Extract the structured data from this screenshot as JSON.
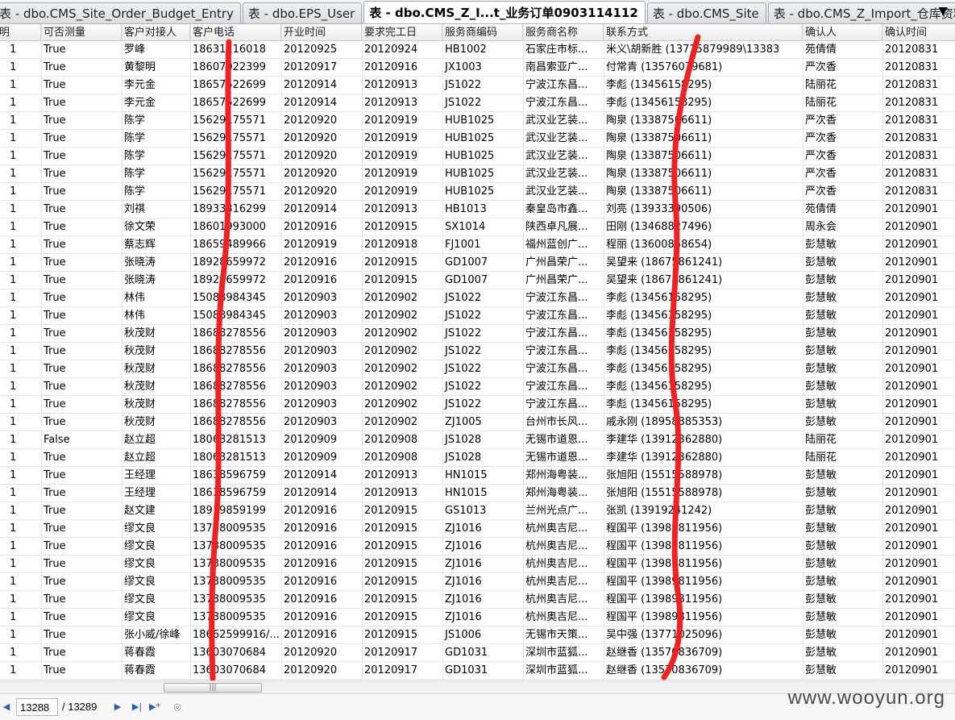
{
  "tabs": [
    {
      "label": "表 - dbo.CMS_Site_Order_Budget_Entry",
      "active": false
    },
    {
      "label": "表 - dbo.EPS_User",
      "active": false
    },
    {
      "label": "表 - dbo.CMS_Z_I...t_业务订单0903114112",
      "active": true
    },
    {
      "label": "表 - dbo.CMS_Site",
      "active": false
    },
    {
      "label": "表 - dbo.CMS_Z_Import_仓库资料",
      "active": false
    }
  ],
  "tab_overflow_icon": "▼",
  "columns": [
    "明",
    "可否测量",
    "客户对接人",
    "客户电话",
    "开业时间",
    "要求完工日",
    "服务商编码",
    "服务商名称",
    "联系方式",
    "确认人",
    "确认时间"
  ],
  "rows": [
    [
      "1",
      "True",
      "罗峰",
      "18631116018",
      "20120925",
      "20120924",
      "HB1002",
      "石家庄市标...",
      "米义\\胡新胜 (13715879989\\13383",
      "苑倩倩",
      "20120831"
    ],
    [
      "1",
      "True",
      "黄黎明",
      "18607022399",
      "20120917",
      "20120916",
      "JX1003",
      "南昌索亚广...",
      "付常青 (13576079681)",
      "严次香",
      "20120831"
    ],
    [
      "1",
      "True",
      "李元金",
      "18657522699",
      "20120914",
      "20120913",
      "JS1022",
      "宁波江东昌...",
      "李彪 (13456158295)",
      "陆丽花",
      "20120831"
    ],
    [
      "1",
      "True",
      "李元金",
      "18657522699",
      "20120914",
      "20120913",
      "JS1022",
      "宁波江东昌...",
      "李彪 (13456158295)",
      "陆丽花",
      "20120831"
    ],
    [
      "1",
      "True",
      "陈学",
      "15629175571",
      "20120920",
      "20120919",
      "HUB1025",
      "武汉业艺装...",
      "陶泉 (13387506611)",
      "严次香",
      "20120831"
    ],
    [
      "1",
      "True",
      "陈学",
      "15629175571",
      "20120920",
      "20120919",
      "HUB1025",
      "武汉业艺装...",
      "陶泉 (13387506611)",
      "严次香",
      "20120831"
    ],
    [
      "1",
      "True",
      "陈学",
      "15629175571",
      "20120920",
      "20120919",
      "HUB1025",
      "武汉业艺装...",
      "陶泉 (13387506611)",
      "严次香",
      "20120831"
    ],
    [
      "1",
      "True",
      "陈学",
      "15629175571",
      "20120920",
      "20120919",
      "HUB1025",
      "武汉业艺装...",
      "陶泉 (13387506611)",
      "严次香",
      "20120831"
    ],
    [
      "1",
      "True",
      "陈学",
      "15629175571",
      "20120920",
      "20120919",
      "HUB1025",
      "武汉业艺装...",
      "陶泉 (13387506611)",
      "严次香",
      "20120831"
    ],
    [
      "1",
      "True",
      "刘祺",
      "18933316299",
      "20120914",
      "20120913",
      "HB1013",
      "秦皇岛市鑫...",
      "刘亮 (13933390506)",
      "苑倩倩",
      "20120901"
    ],
    [
      "1",
      "True",
      "徐文荣",
      "18601993000",
      "20120916",
      "20120915",
      "SX1014",
      "陕西卓凡展...",
      "田刚 (13468827496)",
      "周永会",
      "20120901"
    ],
    [
      "1",
      "True",
      "蔡志辉",
      "18659489966",
      "20120919",
      "20120918",
      "FJ1001",
      "福州蓝创广...",
      "程丽 (13600858654)",
      "彭慧敏",
      "20120901"
    ],
    [
      "1",
      "True",
      "张晓涛",
      "18928659972",
      "20120916",
      "20120915",
      "GD1007",
      "广州昌荣广...",
      "吴望来 (18675861241)",
      "彭慧敏",
      "20120901"
    ],
    [
      "1",
      "True",
      "张晓涛",
      "18928659972",
      "20120916",
      "20120915",
      "GD1007",
      "广州昌荣广...",
      "吴望来 (18675861241)",
      "彭慧敏",
      "20120901"
    ],
    [
      "1",
      "True",
      "林伟",
      "15088984345",
      "20120903",
      "20120902",
      "JS1022",
      "宁波江东昌...",
      "李彪 (13456158295)",
      "彭慧敏",
      "20120901"
    ],
    [
      "1",
      "True",
      "林伟",
      "15088984345",
      "20120903",
      "20120902",
      "JS1022",
      "宁波江东昌...",
      "李彪 (13456158295)",
      "彭慧敏",
      "20120901"
    ],
    [
      "1",
      "True",
      "秋茂财",
      "18688278556",
      "20120903",
      "20120902",
      "JS1022",
      "宁波江东昌...",
      "李彪 (13456158295)",
      "彭慧敏",
      "20120901"
    ],
    [
      "1",
      "True",
      "秋茂财",
      "18688278556",
      "20120903",
      "20120902",
      "JS1022",
      "宁波江东昌...",
      "李彪 (13456158295)",
      "彭慧敏",
      "20120901"
    ],
    [
      "1",
      "True",
      "秋茂财",
      "18688278556",
      "20120903",
      "20120902",
      "JS1022",
      "宁波江东昌...",
      "李彪 (13456158295)",
      "彭慧敏",
      "20120901"
    ],
    [
      "1",
      "True",
      "秋茂财",
      "18688278556",
      "20120903",
      "20120902",
      "JS1022",
      "宁波江东昌...",
      "李彪 (13456158295)",
      "彭慧敏",
      "20120901"
    ],
    [
      "1",
      "True",
      "秋茂财",
      "18688278556",
      "20120903",
      "20120902",
      "JS1022",
      "宁波江东昌...",
      "李彪 (13456158295)",
      "彭慧敏",
      "20120901"
    ],
    [
      "1",
      "True",
      "秋茂财",
      "18688278556",
      "20120903",
      "20120902",
      "ZJ1005",
      "台州市长风...",
      "戚永刚 (18958885353)",
      "彭慧敏",
      "20120901"
    ],
    [
      "1",
      "False",
      "赵立超",
      "18063281513",
      "20120909",
      "20120908",
      "JS1028",
      "无锡市道恩...",
      "李建华 (13912362880)",
      "陆丽花",
      "20120901"
    ],
    [
      "1",
      "True",
      "赵立超",
      "18063281513",
      "20120909",
      "20120908",
      "JS1028",
      "无锡市道恩...",
      "李建华 (13912362880)",
      "陆丽花",
      "20120901"
    ],
    [
      "1",
      "True",
      "王经理",
      "18638596759",
      "20120914",
      "20120913",
      "HN1015",
      "郑州海粤装...",
      "张旭阳 (15515588978)",
      "彭慧敏",
      "20120901"
    ],
    [
      "1",
      "True",
      "王经理",
      "18638596759",
      "20120914",
      "20120913",
      "HN1015",
      "郑州海粤装...",
      "张旭阳 (15515588978)",
      "彭慧敏",
      "20120901"
    ],
    [
      "1",
      "True",
      "赵文建",
      "18919859199",
      "20120916",
      "20120915",
      "GS1013",
      "兰州光点广...",
      "张凯 (13919241242)",
      "彭慧敏",
      "20120901"
    ],
    [
      "1",
      "True",
      "缪文良",
      "13738009535",
      "20120916",
      "20120915",
      "ZJ1016",
      "杭州奥吉尼...",
      "程国平 (13989811956)",
      "彭慧敏",
      "20120901"
    ],
    [
      "1",
      "True",
      "缪文良",
      "13738009535",
      "20120916",
      "20120915",
      "ZJ1016",
      "杭州奥吉尼...",
      "程国平 (13989811956)",
      "彭慧敏",
      "20120901"
    ],
    [
      "1",
      "True",
      "缪文良",
      "13738009535",
      "20120916",
      "20120915",
      "ZJ1016",
      "杭州奥吉尼...",
      "程国平 (13989811956)",
      "彭慧敏",
      "20120901"
    ],
    [
      "1",
      "True",
      "缪文良",
      "13738009535",
      "20120916",
      "20120915",
      "ZJ1016",
      "杭州奥吉尼...",
      "程国平 (13989811956)",
      "彭慧敏",
      "20120901"
    ],
    [
      "1",
      "True",
      "缪文良",
      "13738009535",
      "20120916",
      "20120915",
      "ZJ1016",
      "杭州奥吉尼...",
      "程国平 (13989811956)",
      "彭慧敏",
      "20120901"
    ],
    [
      "1",
      "True",
      "缪文良",
      "13738009535",
      "20120916",
      "20120915",
      "ZJ1016",
      "杭州奥吉尼...",
      "程国平 (13989811956)",
      "彭慧敏",
      "20120901"
    ],
    [
      "1",
      "True",
      "张小威/徐峰",
      "18662599916/...",
      "20120916",
      "20120915",
      "JS1006",
      "无锡市天策...",
      "吴中强 (13771025096)",
      "彭慧敏",
      "20120901"
    ],
    [
      "1",
      "True",
      "蒋春霞",
      "13603070684",
      "20120920",
      "20120917",
      "GD1031",
      "深圳市蓝狐...",
      "赵继香 (13570836709)",
      "彭慧敏",
      "20120901"
    ],
    [
      "1",
      "True",
      "蒋春霞",
      "13603070684",
      "20120920",
      "20120917",
      "GD1031",
      "深圳市蓝狐...",
      "赵继香 (13570836709)",
      "彭慧敏",
      "20120901"
    ]
  ],
  "navigator": {
    "current_page": "13288",
    "total_pages": "/ 13289",
    "first_icon": "◀",
    "next_icon": "▶",
    "last_icon": "▶|",
    "add_icon": "▶*",
    "stop_icon": "◎"
  },
  "scrollbar": {
    "thumb_grip": "|||"
  },
  "watermark": "www.wooyun.org",
  "colors": {
    "scribble": "#ee2222",
    "nav_icon": "#1f5fb8",
    "active_tab": "#ffffff"
  }
}
